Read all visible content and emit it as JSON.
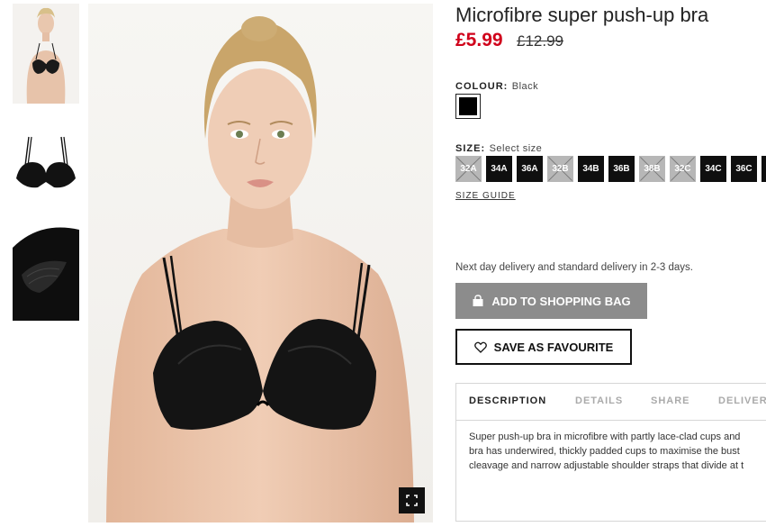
{
  "product": {
    "title": "Microfibre super push-up bra",
    "price_now": "£5.99",
    "price_was": "£12.99"
  },
  "colour": {
    "label": "COLOUR:",
    "value": "Black",
    "swatch_color": "#000000"
  },
  "size": {
    "label": "SIZE:",
    "value": "Select size",
    "options": [
      {
        "label": "32A",
        "available": false
      },
      {
        "label": "34A",
        "available": true
      },
      {
        "label": "36A",
        "available": true
      },
      {
        "label": "32B",
        "available": false
      },
      {
        "label": "34B",
        "available": true
      },
      {
        "label": "36B",
        "available": true
      },
      {
        "label": "38B",
        "available": false
      },
      {
        "label": "32C",
        "available": false
      },
      {
        "label": "34C",
        "available": true
      },
      {
        "label": "36C",
        "available": true
      }
    ],
    "guide_label": "SIZE GUIDE"
  },
  "delivery_text": "Next day delivery and standard delivery in 2-3 days.",
  "actions": {
    "add_to_bag": "ADD TO SHOPPING BAG",
    "save_favourite": "SAVE AS FAVOURITE"
  },
  "tabs": [
    {
      "label": "DESCRIPTION",
      "active": true
    },
    {
      "label": "DETAILS",
      "active": false
    },
    {
      "label": "SHARE",
      "active": false
    },
    {
      "label": "DELIVERY",
      "active": false
    }
  ],
  "description_lines": [
    "Super push-up bra in microfibre with partly lace-clad cups and",
    "bra has underwired, thickly padded cups to maximise the bust",
    "cleavage and narrow adjustable shoulder straps that divide at t"
  ],
  "colors": {
    "sale_red": "#d0021b",
    "bag_button": "#8c8c8c"
  },
  "icons": {
    "bag": "shopping-bag-icon",
    "heart": "heart-icon",
    "fullscreen": "fullscreen-icon"
  }
}
